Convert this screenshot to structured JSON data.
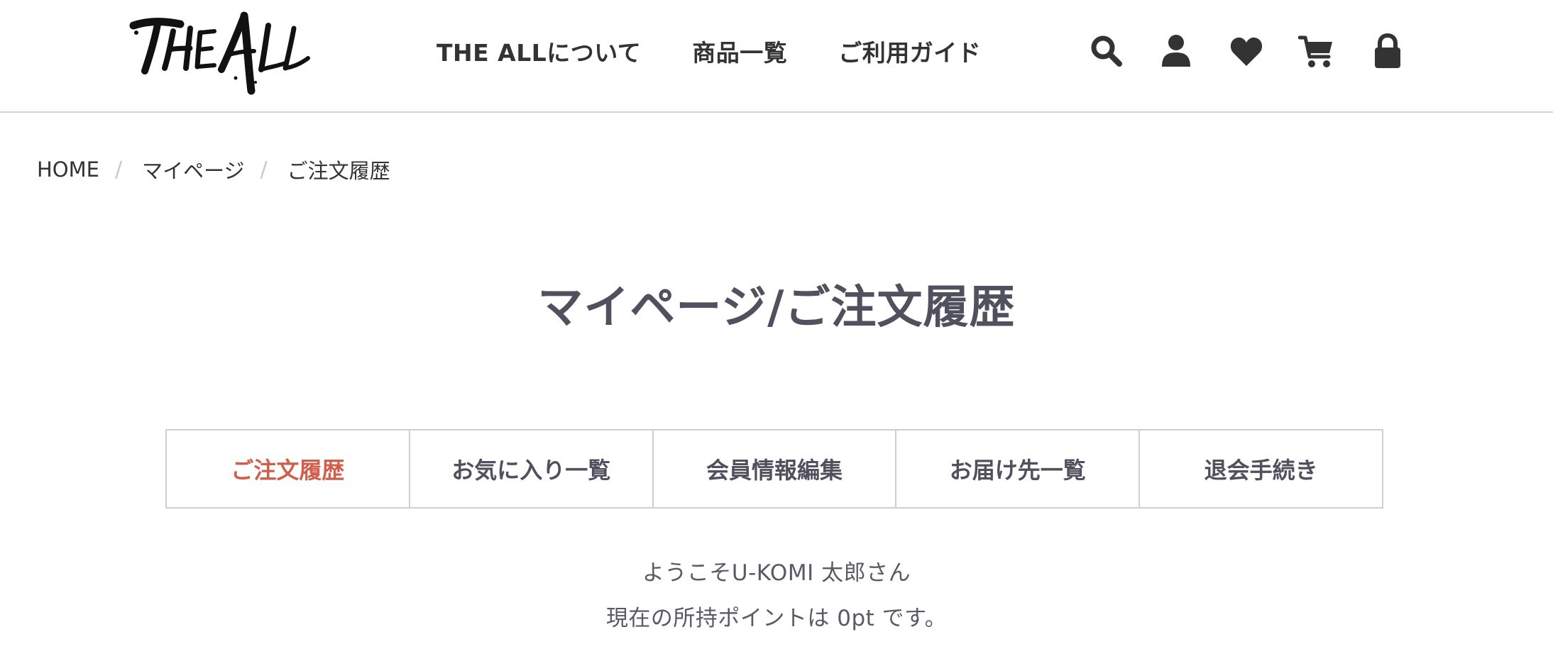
{
  "header": {
    "logo_text": "THE ALL",
    "nav": [
      {
        "label": "THE ALLについて"
      },
      {
        "label": "商品一覧"
      },
      {
        "label": "ご利用ガイド"
      }
    ],
    "icons": [
      "search-icon",
      "user-icon",
      "heart-icon",
      "cart-icon",
      "lock-icon"
    ]
  },
  "breadcrumb": {
    "items": [
      "HOME",
      "マイページ",
      "ご注文履歴"
    ],
    "separator": "/"
  },
  "page": {
    "title": "マイページ/ご注文履歴"
  },
  "tabs": [
    {
      "label": "ご注文履歴",
      "active": true
    },
    {
      "label": "お気に入り一覧",
      "active": false
    },
    {
      "label": "会員情報編集",
      "active": false
    },
    {
      "label": "お届け先一覧",
      "active": false
    },
    {
      "label": "退会手続き",
      "active": false
    }
  ],
  "member": {
    "welcome": "ようこそU-KOMI 太郎さん",
    "points": "現在の所持ポイントは 0pt です。"
  },
  "colors": {
    "accent": "#cf5f4c",
    "text": "#50505e",
    "icon": "#333333",
    "border": "#cfcfcf"
  }
}
